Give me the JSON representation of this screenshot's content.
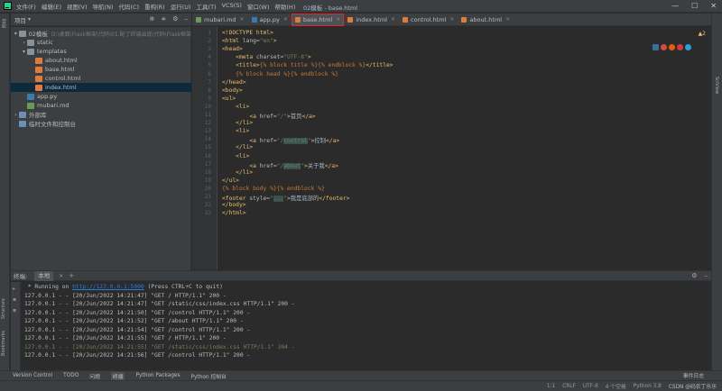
{
  "menubar": {
    "items": [
      "文件(F)",
      "编辑(E)",
      "视图(V)",
      "导航(N)",
      "代码(C)",
      "重构(R)",
      "运行(U)",
      "工具(T)",
      "VCS(S)",
      "窗口(W)",
      "帮助(H)"
    ],
    "title": "02模板 - base.html",
    "window_buttons": [
      "—",
      "☐",
      "✕"
    ]
  },
  "project": {
    "title": "项目",
    "items": [
      {
        "label": "02模板",
        "path": "D:\\桌面\\Flask框架\\代码\\01.配了终端出现\\代码\\Flask框架",
        "arrow": "▾",
        "type": "folder",
        "indent": 0
      },
      {
        "label": "static",
        "arrow": "›",
        "type": "folder",
        "indent": 1
      },
      {
        "label": "templates",
        "arrow": "▾",
        "type": "folder",
        "indent": 1
      },
      {
        "label": "about.html",
        "arrow": "",
        "type": "html",
        "indent": 2
      },
      {
        "label": "base.html",
        "arrow": "",
        "type": "html",
        "indent": 2
      },
      {
        "label": "control.html",
        "arrow": "",
        "type": "html",
        "indent": 2
      },
      {
        "label": "index.html",
        "arrow": "",
        "type": "html",
        "indent": 2,
        "selected": true
      },
      {
        "label": "app.py",
        "arrow": "",
        "type": "py",
        "indent": 1
      },
      {
        "label": "mubari.md",
        "arrow": "",
        "type": "md",
        "indent": 1
      },
      {
        "label": "外部库",
        "arrow": "›",
        "type": "lib",
        "indent": 0
      },
      {
        "label": "临时文件和控制台",
        "arrow": "",
        "type": "lib",
        "indent": 0
      }
    ]
  },
  "tabs": [
    {
      "label": "mubari.md",
      "icon": "markdown-icon",
      "color": "#6a9a5a"
    },
    {
      "label": "app.py",
      "icon": "python-icon",
      "color": "#3c7ab0"
    },
    {
      "label": "base.html",
      "icon": "html-icon",
      "color": "#e07c3a",
      "active": true,
      "highlighted": true
    },
    {
      "label": "index.html",
      "icon": "html-icon",
      "color": "#e07c3a"
    },
    {
      "label": "control.html",
      "icon": "html-icon",
      "color": "#e07c3a"
    },
    {
      "label": "about.html",
      "icon": "html-icon",
      "color": "#e07c3a"
    }
  ],
  "editor": {
    "warning_count": "▲2",
    "line_numbers": [
      "1",
      "2",
      "3",
      "4",
      "5",
      "6",
      "7",
      "8",
      "9",
      "10",
      "11",
      "12",
      "13",
      "14",
      "15",
      "16",
      "17",
      "18",
      "19",
      "20",
      "21",
      "22",
      "23"
    ],
    "lines": [
      [
        {
          "t": "<!DOCTYPE html>",
          "c": "t"
        }
      ],
      [
        {
          "t": "<html ",
          "c": "t"
        },
        {
          "t": "lang=",
          "c": "a"
        },
        {
          "t": "\"en\"",
          "c": "s"
        },
        {
          "t": ">",
          "c": "t"
        }
      ],
      [
        {
          "t": "<head>",
          "c": "t"
        }
      ],
      [
        {
          "t": "    <meta ",
          "c": "t"
        },
        {
          "t": "charset=",
          "c": "a"
        },
        {
          "t": "\"UTF-8\"",
          "c": "s"
        },
        {
          "t": ">",
          "c": "t"
        }
      ],
      [
        {
          "t": "    <title>",
          "c": "t"
        },
        {
          "t": "{% block title %}{% endblock %}",
          "c": "j"
        },
        {
          "t": "</title>",
          "c": "t"
        }
      ],
      [
        {
          "t": "    {% block head %}{% endblock %}",
          "c": "j"
        }
      ],
      [
        {
          "t": "</head>",
          "c": "t"
        }
      ],
      [
        {
          "t": "<body>",
          "c": "t"
        }
      ],
      [
        {
          "t": "<ul>",
          "c": "t"
        }
      ],
      [
        {
          "t": "    <li>",
          "c": "t"
        }
      ],
      [
        {
          "t": "        <a ",
          "c": "t"
        },
        {
          "t": "href=",
          "c": "a"
        },
        {
          "t": "\"/\"",
          "c": "s"
        },
        {
          "t": ">",
          "c": "t"
        },
        {
          "t": "首页",
          "c": "n"
        },
        {
          "t": "</a>",
          "c": "t"
        }
      ],
      [
        {
          "t": "    </li>",
          "c": "t"
        }
      ],
      [
        {
          "t": "    <li>",
          "c": "t"
        }
      ],
      [
        {
          "t": "        <a ",
          "c": "t"
        },
        {
          "t": "href=",
          "c": "a"
        },
        {
          "t": "\"/",
          "c": "s"
        },
        {
          "t": "control",
          "c": "sh"
        },
        {
          "t": "\"",
          "c": "s"
        },
        {
          "t": ">",
          "c": "t"
        },
        {
          "t": "控制",
          "c": "n"
        },
        {
          "t": "</a>",
          "c": "t"
        }
      ],
      [
        {
          "t": "    </li>",
          "c": "t"
        }
      ],
      [
        {
          "t": "    <li>",
          "c": "t"
        }
      ],
      [
        {
          "t": "        <a ",
          "c": "t"
        },
        {
          "t": "href=",
          "c": "a"
        },
        {
          "t": "\"/",
          "c": "s"
        },
        {
          "t": "about",
          "c": "sh"
        },
        {
          "t": "\"",
          "c": "s"
        },
        {
          "t": ">",
          "c": "t"
        },
        {
          "t": "关于我",
          "c": "n"
        },
        {
          "t": "</a>",
          "c": "t"
        }
      ],
      [
        {
          "t": "    </li>",
          "c": "t"
        }
      ],
      [
        {
          "t": "</ul>",
          "c": "t"
        }
      ],
      [
        {
          "t": "{% block body %}{% endblock %}",
          "c": "j"
        }
      ],
      [
        {
          "t": "<footer ",
          "c": "t"
        },
        {
          "t": "style=",
          "c": "a"
        },
        {
          "t": "\"",
          "c": "s"
        },
        {
          "t": "...",
          "c": "sh"
        },
        {
          "t": "\"",
          "c": "s"
        },
        {
          "t": ">",
          "c": "t"
        },
        {
          "t": "我是底部的",
          "c": "n"
        },
        {
          "t": "</footer>",
          "c": "t"
        }
      ],
      [
        {
          "t": "</body>",
          "c": "t"
        }
      ],
      [
        {
          "t": "</html>",
          "c": "t"
        }
      ]
    ]
  },
  "terminal": {
    "header_label": "终端:",
    "tab_label": "本地",
    "close": "×",
    "add": "+",
    "running_prefix": " * Running on ",
    "running_link": "http://127.0.0.1:5000",
    "running_suffix": " (Press CTRL+C to quit)",
    "logs": [
      {
        "text": "127.0.0.1 - - [20/Jun/2022 14:21:47] \"GET / HTTP/1.1\" 200 -",
        "green": false
      },
      {
        "text": "127.0.0.1 - - [20/Jun/2022 14:21:47] \"GET /static/css/index.css HTTP/1.1\" 200 -",
        "green": false
      },
      {
        "text": "127.0.0.1 - - [20/Jun/2022 14:21:50] \"GET /control HTTP/1.1\" 200 -",
        "green": false
      },
      {
        "text": "127.0.0.1 - - [20/Jun/2022 14:21:52] \"GET /about HTTP/1.1\" 200 -",
        "green": false
      },
      {
        "text": "127.0.0.1 - - [20/Jun/2022 14:21:54] \"GET /control HTTP/1.1\" 200 -",
        "green": false
      },
      {
        "text": "127.0.0.1 - - [20/Jun/2022 14:21:55] \"GET / HTTP/1.1\" 200 -",
        "green": false
      },
      {
        "text": "127.0.0.1 - - [20/Jun/2022 14:21:55] \"GET /static/css/index.css HTTP/1.1\" 304 -",
        "green": true
      },
      {
        "text": "127.0.0.1 - - [20/Jun/2022 14:21:56] \"GET /control HTTP/1.1\" 200 -",
        "green": false
      }
    ]
  },
  "left_stripe": {
    "top": "项目",
    "structure": "Structure",
    "bookmarks": "Bookmarks"
  },
  "right_stripe": {
    "label": "SciView"
  },
  "toolwindows": {
    "items": [
      "Version Control",
      "TODO",
      "问题",
      "终端",
      "Python Packages",
      "Python 控制台"
    ],
    "active_index": 3,
    "event_log": "事件日志"
  },
  "statusbar": {
    "items": [
      "1:1",
      "CRLF",
      "UTF-8",
      "4 个空格",
      "Python 3.8"
    ],
    "watermark": "CSDN @码农丁乐乐"
  }
}
